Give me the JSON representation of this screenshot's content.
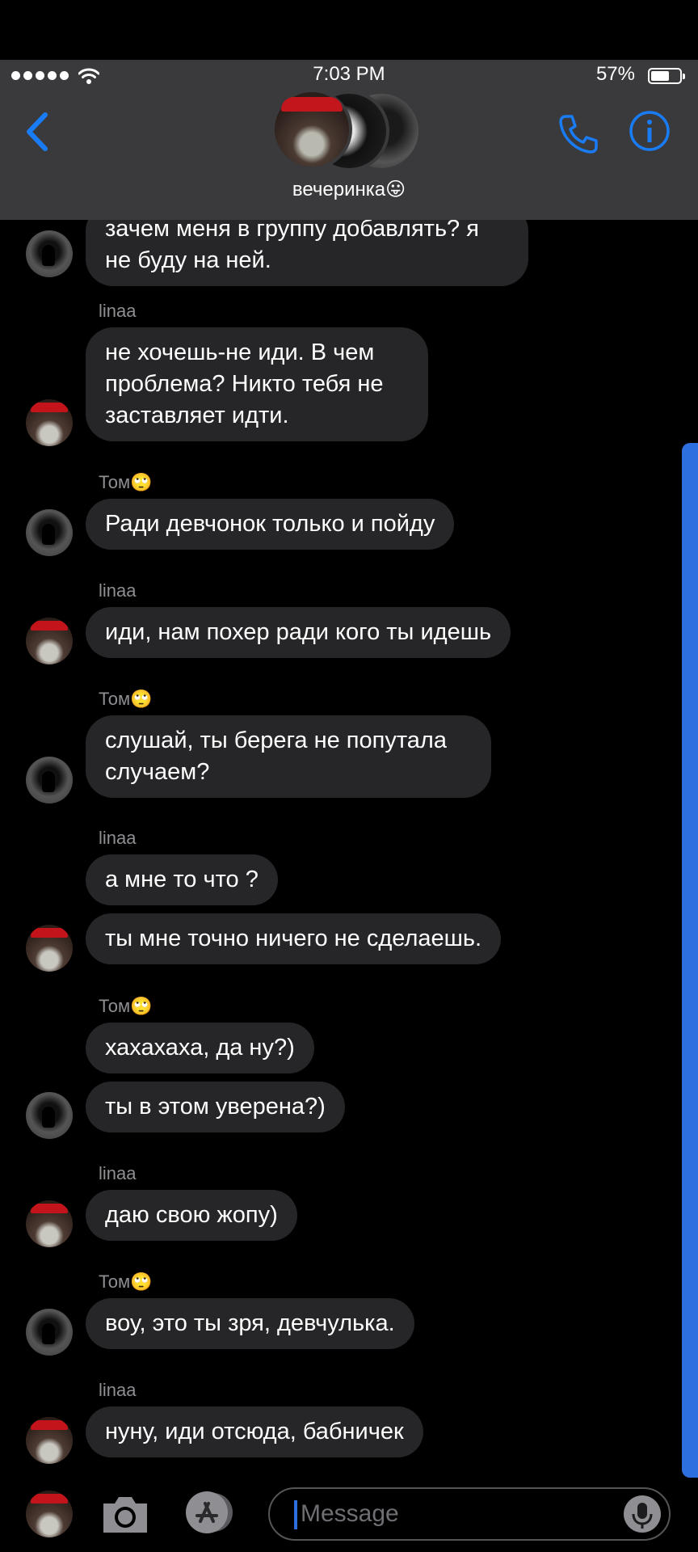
{
  "status_bar": {
    "time": "7:03 PM",
    "battery": "57%",
    "battery_level": 0.57
  },
  "header": {
    "group_name": "вечеринка😛"
  },
  "messages": [
    {
      "sender": "",
      "text": "зачем меня в группу добавлять? я не буду на ней.",
      "author": "tom"
    },
    {
      "sender": "linaa",
      "text": "не хочешь-не иди. В чем проблема? Никто тебя не заставляет идти.",
      "author": "linaa"
    },
    {
      "sender": "Том🙄",
      "text": "Ради девчонок только и пойду",
      "author": "tom"
    },
    {
      "sender": "linaa",
      "text": "иди, нам похер ради кого ты идешь",
      "author": "linaa"
    },
    {
      "sender": "Том🙄",
      "text": "слушай, ты берега не попутала случаем?",
      "author": "tom"
    },
    {
      "sender": "linaa",
      "text": "а мне то что ?",
      "author": "linaa"
    },
    {
      "sender": "",
      "text": "ты мне точно ничего не сделаешь.",
      "author": "linaa"
    },
    {
      "sender": "Том🙄",
      "text": "хахахаха, да ну?)",
      "author": "tom"
    },
    {
      "sender": "",
      "text": "ты в этом уверена?)",
      "author": "tom"
    },
    {
      "sender": "linaa",
      "text": "даю свою жопу)",
      "author": "linaa"
    },
    {
      "sender": "Том🙄",
      "text": "воу, это ты зря, девчулька.",
      "author": "tom"
    },
    {
      "sender": "linaa",
      "text": "нуну, иди отсюда, бабничек",
      "author": "linaa"
    }
  ],
  "input": {
    "placeholder": "Message"
  }
}
